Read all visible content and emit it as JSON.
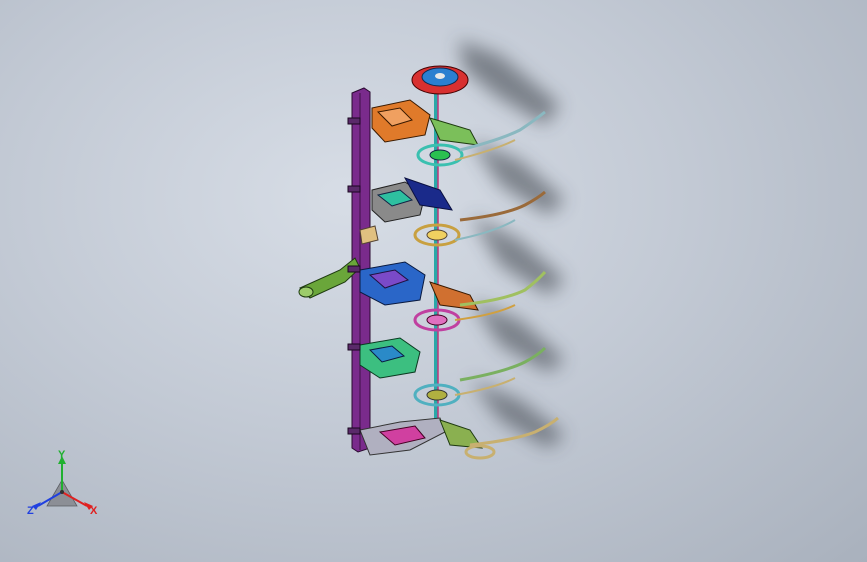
{
  "view": {
    "background_top": "#d7dde6",
    "background_bottom": "#a9b1bd"
  },
  "triad": {
    "x_label": "X",
    "y_label": "Y",
    "z_label": "Z",
    "x_color": "#e02020",
    "y_color": "#20b030",
    "z_color": "#2040e0"
  }
}
